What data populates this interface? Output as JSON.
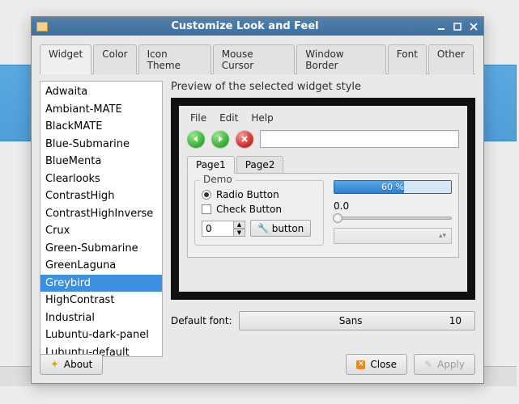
{
  "window": {
    "title": "Customize Look and Feel"
  },
  "tabs": [
    "Widget",
    "Color",
    "Icon Theme",
    "Mouse Cursor",
    "Window Border",
    "Font",
    "Other"
  ],
  "active_tab": 0,
  "themes": [
    "Adwaita",
    "Ambiant-MATE",
    "BlackMATE",
    "Blue-Submarine",
    "BlueMenta",
    "Clearlooks",
    "ContrastHigh",
    "ContrastHighInverse",
    "Crux",
    "Green-Submarine",
    "GreenLaguna",
    "Greybird",
    "HighContrast",
    "Industrial",
    "Lubuntu-dark-panel",
    "Lubuntu-default"
  ],
  "selected_theme": "Greybird",
  "preview_label": "Preview of the selected widget style",
  "preview": {
    "menubar": [
      "File",
      "Edit",
      "Help"
    ],
    "tabs": [
      "Page1",
      "Page2"
    ],
    "demo_label": "Demo",
    "radio_label": "Radio Button",
    "check_label": "Check Button",
    "spin_value": "0",
    "button_label": "button",
    "progress_label": "60 %",
    "slider_label": "0.0"
  },
  "default_font": {
    "label": "Default font:",
    "family": "Sans",
    "size": "10"
  },
  "buttons": {
    "about": "About",
    "close": "Close",
    "apply": "Apply"
  },
  "colors": {
    "accent": "#3d8fe0",
    "titlebar": "#3d6f9f"
  }
}
